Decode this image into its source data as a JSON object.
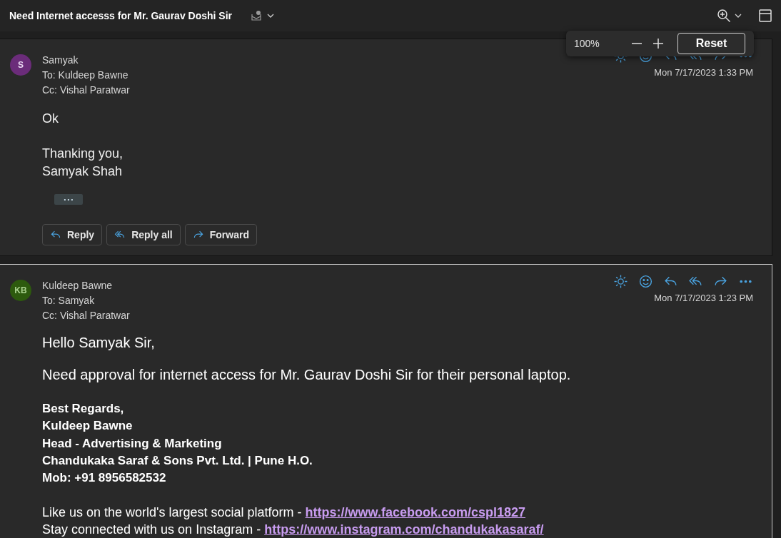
{
  "subject": "Need Internet accesss for Mr. Gaurav Doshi Sir",
  "zoom_popup": {
    "value": "100%",
    "reset": "Reset"
  },
  "messages": [
    {
      "selected": false,
      "initials": "S",
      "color": "#6b2c7a",
      "sender": "Samyak",
      "to": "To: Kuldeep Bawne",
      "cc": "Cc: Vishal Paratwar",
      "date": "Mon 7/17/2023 1:33 PM",
      "body": [
        {
          "kind": "plain",
          "text": "Ok"
        },
        {
          "kind": "gap"
        },
        {
          "kind": "plain",
          "text": "Thanking you,"
        },
        {
          "kind": "plain",
          "text": "Samyak Shah"
        }
      ],
      "show_more": "• • •",
      "actions": [
        "Reply",
        "Reply all",
        "Forward"
      ]
    },
    {
      "selected": true,
      "initials": "KB",
      "color": "#2d5a0e",
      "sender": "Kuldeep Bawne",
      "to": "To: Samyak",
      "cc": "Cc: Vishal Paratwar",
      "date": "Mon 7/17/2023 1:23 PM",
      "body": [
        {
          "kind": "large",
          "text": "Hello Samyak Sir,"
        },
        {
          "kind": "large",
          "text": "Need approval for internet access for Mr. Gaurav Doshi Sir for their personal laptop."
        },
        {
          "kind": "bold",
          "text": "Best Regards,"
        },
        {
          "kind": "bold",
          "text": "Kuldeep Bawne"
        },
        {
          "kind": "bold",
          "text": "Head - Advertising & Marketing"
        },
        {
          "kind": "bold",
          "text": "Chandukaka Saraf & Sons Pvt. Ltd. | Pune H.O."
        },
        {
          "kind": "bold",
          "text": "Mob: +91 8956582532"
        },
        {
          "kind": "gap"
        },
        {
          "kind": "link",
          "text": "Like us on the world's largest social platform - ",
          "link": "https://www.facebook.com/cspl1827"
        },
        {
          "kind": "link",
          "text": "Stay connected with us on Instagram - ",
          "link": "https://www.instagram.com/chandukakasaraf/"
        }
      ]
    }
  ]
}
